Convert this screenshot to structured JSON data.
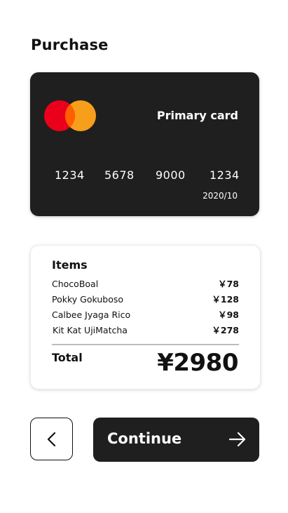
{
  "page": {
    "title": "Purchase"
  },
  "card": {
    "brand_icon": "mastercard-logo-icon",
    "label": "Primary card",
    "number_groups": [
      "1234",
      "5678",
      "9000",
      "1234"
    ],
    "expiry": "2020/10",
    "colors": {
      "background": "#1f1f1f",
      "mc_red": "#eb001b",
      "mc_orange": "#f79e1b"
    }
  },
  "receipt": {
    "heading": "Items",
    "items": [
      {
        "name": "ChocoBoal",
        "price": "￥78"
      },
      {
        "name": "Pokky Gokuboso",
        "price": "￥128"
      },
      {
        "name": "Calbee Jyaga Rico",
        "price": "￥98"
      },
      {
        "name": "Kit Kat UjiMatcha",
        "price": "￥278"
      }
    ],
    "total_label": "Total",
    "total_value": "¥2980"
  },
  "actions": {
    "back_icon": "chevron-left-icon",
    "continue_label": "Continue",
    "continue_icon": "arrow-right-icon"
  }
}
